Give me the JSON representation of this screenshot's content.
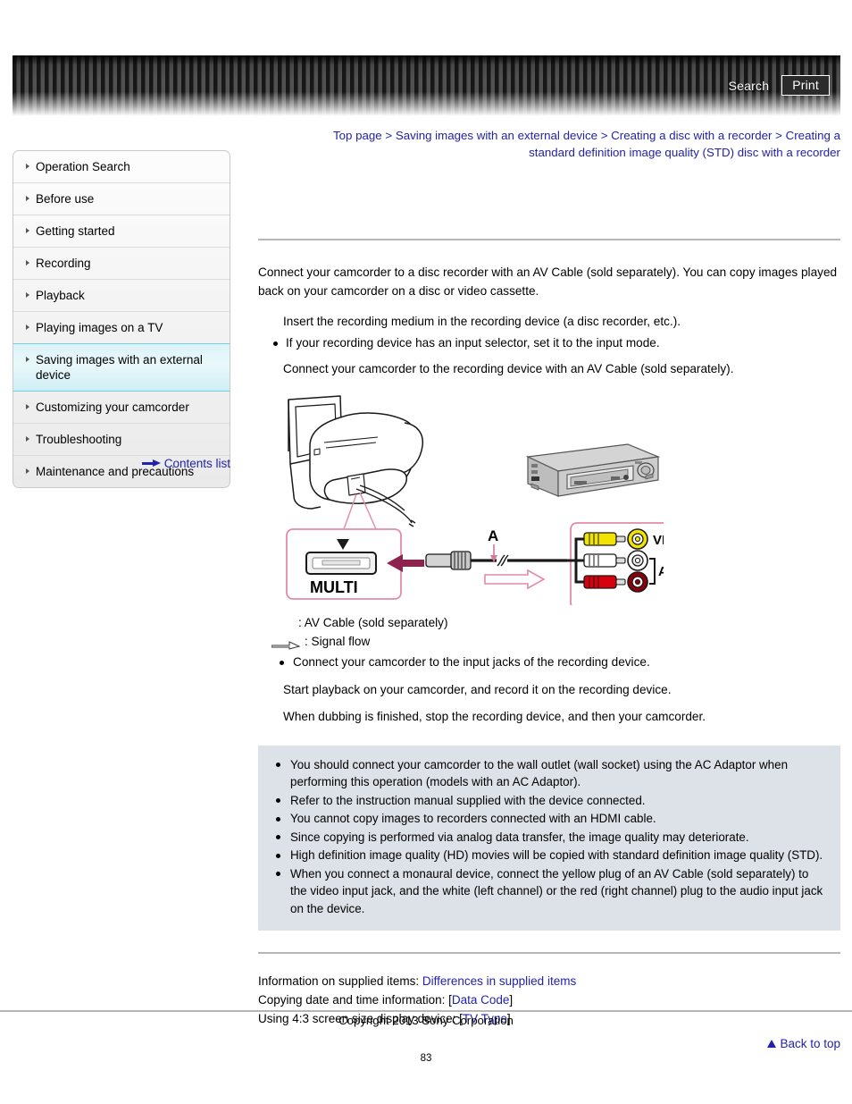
{
  "header": {
    "search_label": "Search",
    "print_label": "Print"
  },
  "breadcrumb": {
    "items": [
      "Top page",
      "Saving images with an external device",
      "Creating a disc with a recorder",
      "Creating a standard definition image quality (STD) disc with a recorder"
    ],
    "separator": " > ",
    "line1": "Top page > Saving images with an external device > Creating a disc with a recorder > Creating a",
    "line2": "standard definition image quality (STD) disc with a recorder"
  },
  "sidebar": {
    "items": [
      {
        "label": "Operation Search",
        "selected": false
      },
      {
        "label": "Before use",
        "selected": false
      },
      {
        "label": "Getting started",
        "selected": false
      },
      {
        "label": "Recording",
        "selected": false
      },
      {
        "label": "Playback",
        "selected": false
      },
      {
        "label": "Playing images on a TV",
        "selected": false
      },
      {
        "label": "Saving images with an external device",
        "selected": true
      },
      {
        "label": "Customizing your camcorder",
        "selected": false
      },
      {
        "label": "Troubleshooting",
        "selected": false
      },
      {
        "label": "Maintenance and precautions",
        "selected": false
      }
    ],
    "contents_list_label": "Contents list"
  },
  "main": {
    "intro": "Connect your camcorder to a disc recorder with an AV Cable (sold separately). You can copy images played back on your camcorder on a disc or video cassette.",
    "step1": "Insert the recording medium in the recording device (a disc recorder, etc.).",
    "step1_note": "If your recording device has an input selector, set it to the input mode.",
    "step2": "Connect your camcorder to the recording device with an AV Cable (sold separately).",
    "legend_cable": ": AV Cable (sold separately)",
    "legend_flow": ": Signal flow",
    "legend_note": "Connect your camcorder to the input jacks of the recording device.",
    "step3": "Start playback on your camcorder, and record it on the recording device.",
    "step4": "When dubbing is finished, stop the recording device, and then your camcorder."
  },
  "diagram": {
    "connector_label": "MULTI",
    "cable_label": "A",
    "video_label": "VIDEO",
    "audio_label": "AUDIO",
    "colors": {
      "yellow": "#f2e400",
      "white": "#ffffff",
      "red": "#d8000d",
      "pink_frame": "#e8a6bd",
      "arrow_magenta": "#9e2a5a"
    }
  },
  "notes": {
    "items": [
      "You should connect your camcorder to the wall outlet (wall socket) using the AC Adaptor when performing this operation (models with an AC Adaptor).",
      "Refer to the instruction manual supplied with the device connected.",
      "You cannot copy images to recorders connected with an HDMI cable.",
      "Since copying is performed via analog data transfer, the image quality may deteriorate.",
      "High definition image quality (HD) movies will be copied with standard definition image quality (STD).",
      "When you connect a monaural device, connect the yellow plug of an AV Cable (sold separately) to the video input jack, and the white (left channel) or the red (right channel) plug to the audio input jack on the device."
    ]
  },
  "info_links": {
    "line1_prefix": "Information on supplied items: ",
    "line1_link": "Differences in supplied items",
    "line2_prefix": "Copying date and time information: [",
    "line2_link": "Data Code",
    "line2_suffix": "]",
    "line3_prefix": "Using 4:3 screen size display device: [",
    "line3_link": "TV Type",
    "line3_suffix": "]",
    "back_to_top": "Back to top"
  },
  "footer": {
    "copyright": "Copyright 2013 Sony Corporation",
    "page_number": "83"
  }
}
